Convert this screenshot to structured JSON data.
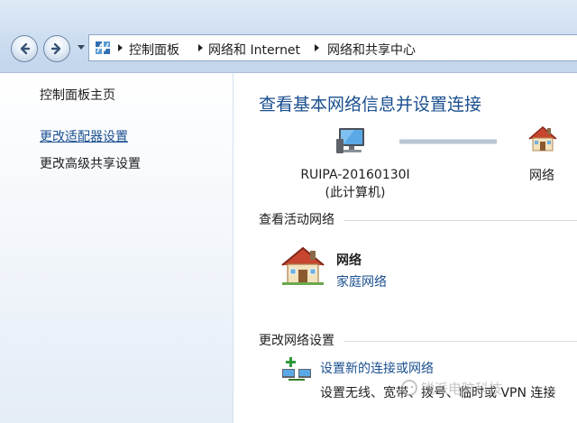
{
  "address_bar": {
    "crumbs": [
      "控制面板",
      "网络和 Internet",
      "网络和共享中心"
    ]
  },
  "sidebar": {
    "items": [
      {
        "label": "控制面板主页"
      },
      {
        "label": "更改适配器设置"
      },
      {
        "label": "更改高级共享设置"
      }
    ]
  },
  "main": {
    "title": "查看基本网络信息并设置连接",
    "network_map": {
      "computer_name": "RUIPA-20160130I",
      "computer_sub": "(此计算机)",
      "network_label": "网络"
    },
    "active_networks": {
      "heading": "查看活动网络",
      "network_name": "网络",
      "network_type": "家庭网络"
    },
    "change_settings": {
      "heading": "更改网络设置",
      "task_link": "设置新的连接或网络",
      "task_desc": "设置无线、宽带、拨号、临时或 VPN 连接"
    }
  },
  "watermark": "锐派电脑科技",
  "icons": {
    "back": "back-arrow-icon",
    "forward": "forward-arrow-icon",
    "control_panel": "control-panel-icon",
    "computer": "computer-icon",
    "house": "house-icon",
    "new_connection": "new-connection-icon"
  }
}
